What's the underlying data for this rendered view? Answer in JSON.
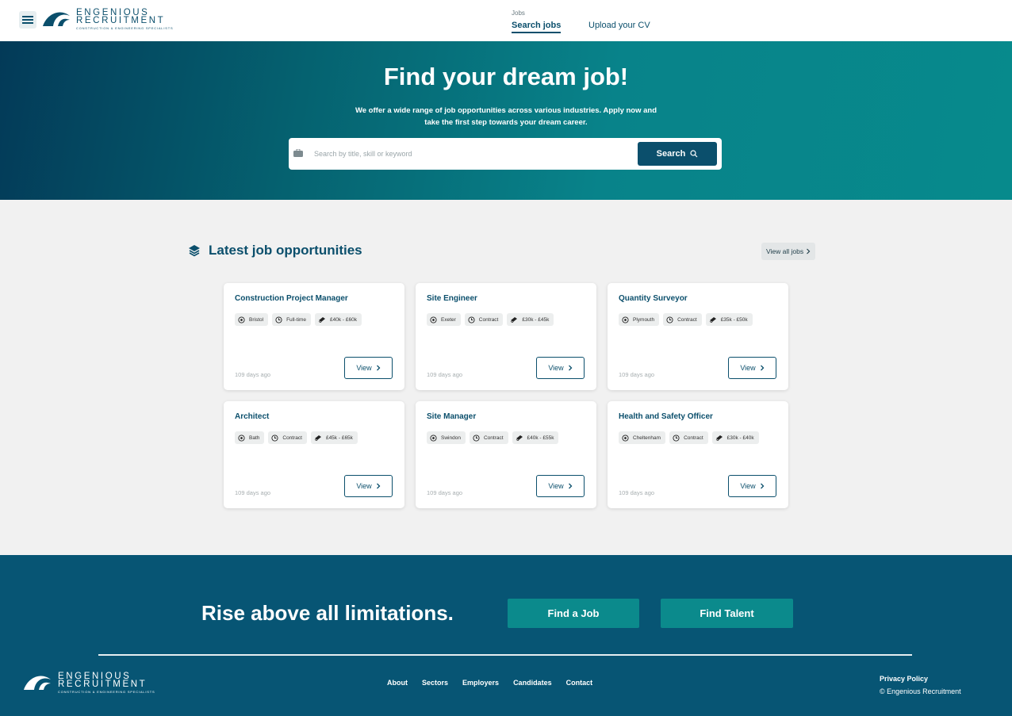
{
  "header": {
    "logo_line1": "ENGENIOUS",
    "logo_line2": "RECRUITMENT",
    "logo_tagline": "CONSTRUCTION & ENGINEERING SPECIALISTS",
    "nav_group_label": "Jobs",
    "nav_search_jobs": "Search jobs",
    "nav_upload_cv": "Upload your CV"
  },
  "hero": {
    "title": "Find your dream job!",
    "subtitle": "We offer a wide range of job opportunities across various industries. Apply now and take the first step towards your dream career.",
    "search_placeholder": "Search by title, skill or keyword",
    "search_value": "",
    "search_button": "Search"
  },
  "latest": {
    "title": "Latest job opportunities",
    "view_all": "View all jobs",
    "jobs": [
      {
        "title": "Construction Project Manager",
        "location": "Bristol",
        "type": "Full-time",
        "salary": "£40k - £60k",
        "age": "109 days ago",
        "view": "View"
      },
      {
        "title": "Site Engineer",
        "location": "Exeter",
        "type": "Contract",
        "salary": "£30k - £45k",
        "age": "109 days ago",
        "view": "View"
      },
      {
        "title": "Quantity Surveyor",
        "location": "Plymouth",
        "type": "Contract",
        "salary": "£35k - £50k",
        "age": "109 days ago",
        "view": "View"
      },
      {
        "title": "Architect",
        "location": "Bath",
        "type": "Contract",
        "salary": "£45k - £65k",
        "age": "109 days ago",
        "view": "View"
      },
      {
        "title": "Site Manager",
        "location": "Swindon",
        "type": "Contract",
        "salary": "£40k - £55k",
        "age": "109 days ago",
        "view": "View"
      },
      {
        "title": "Health and Safety Officer",
        "location": "Cheltenham",
        "type": "Contract",
        "salary": "£30k - £40k",
        "age": "109 days ago",
        "view": "View"
      }
    ]
  },
  "cta": {
    "headline": "Rise above all limitations.",
    "find_job": "Find a Job",
    "find_talent": "Find Talent"
  },
  "footer": {
    "links": [
      "About",
      "Sectors",
      "Employers",
      "Candidates",
      "Contact"
    ],
    "privacy": "Privacy Policy",
    "copyright": "© Engenious Recruitment"
  },
  "colors": {
    "brand": "#0b4f6c",
    "accent": "#0b8a8c",
    "footer_bg": "#075574"
  }
}
